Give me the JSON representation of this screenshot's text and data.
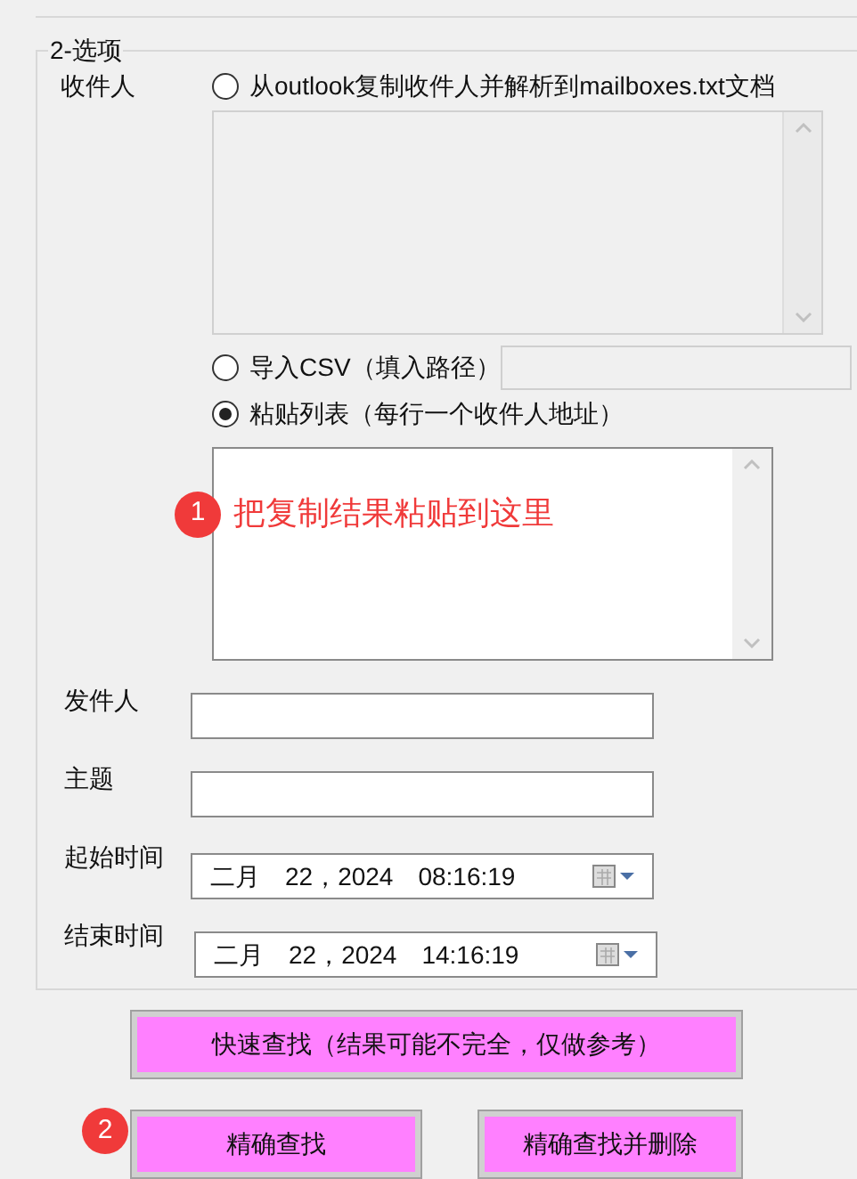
{
  "group": {
    "title": "2-选项"
  },
  "recipients": {
    "label": "收件人",
    "options": [
      {
        "kind": "textarea-source",
        "label": "从outlook复制收件人并解析到mailboxes.txt文档",
        "selected": false
      },
      {
        "kind": "path",
        "label": "导入CSV（填入路径）",
        "selected": false
      },
      {
        "kind": "paste",
        "label": "粘贴列表（每行一个收件人地址）",
        "selected": true
      }
    ],
    "paste_hint": {
      "number": "1",
      "text": "把复制结果粘贴到这里"
    }
  },
  "fields": [
    {
      "kind": "text",
      "label": "发件人"
    },
    {
      "kind": "text",
      "label": "主题"
    },
    {
      "kind": "datetime",
      "label": "起始时间",
      "month": "二月",
      "date": "22，2024",
      "time": "08:16:19"
    },
    {
      "kind": "datetime",
      "label": "结束时间",
      "month": "二月",
      "date": "22，2024",
      "time": "14:16:19"
    }
  ],
  "buttons": [
    {
      "label": "快速查找（结果可能不完全，仅做参考）"
    },
    {
      "label": "精确查找",
      "badge": "2"
    },
    {
      "label": "精确查找并删除"
    }
  ]
}
